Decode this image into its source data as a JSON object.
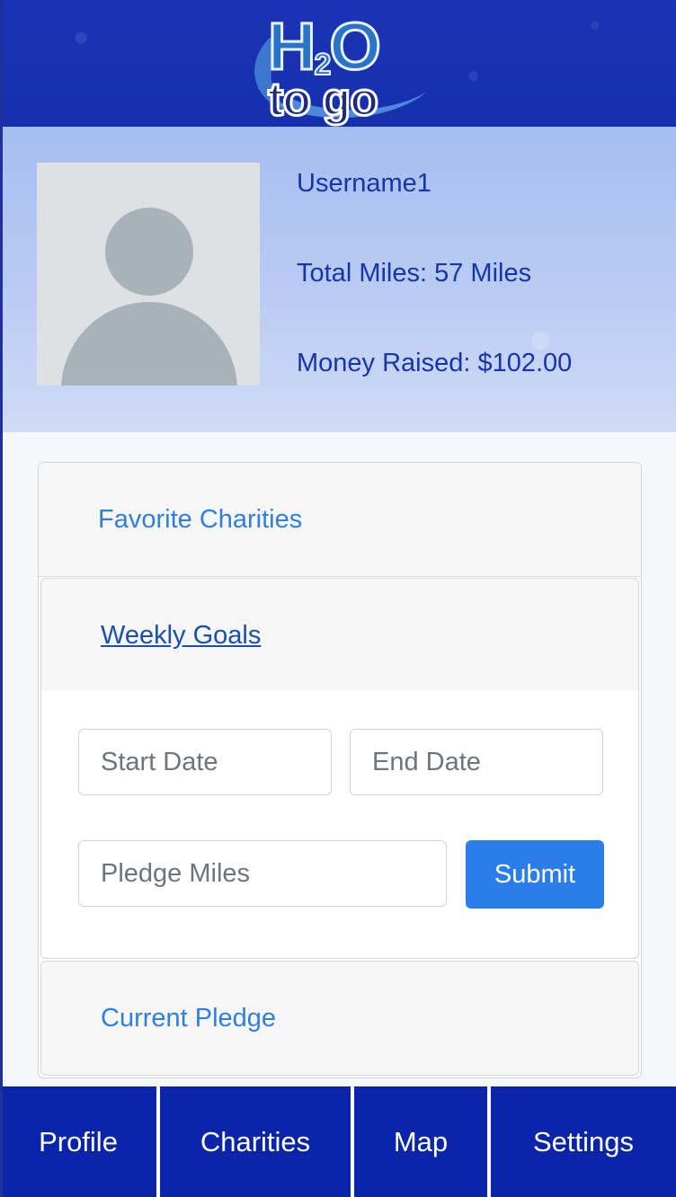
{
  "app": {
    "logo_line1": "H",
    "logo_sub": "2",
    "logo_line1b": "O",
    "logo_line2": "to go"
  },
  "profile": {
    "username": "Username1",
    "total_miles": "Total Miles: 57 Miles",
    "money_raised": "Money Raised: $102.00"
  },
  "accordion": {
    "favorite_charities": "Favorite Charities",
    "weekly_goals": "Weekly Goals",
    "current_pledge": "Current Pledge"
  },
  "form": {
    "start_date_placeholder": "Start Date",
    "end_date_placeholder": "End Date",
    "pledge_miles_placeholder": "Pledge Miles",
    "submit_label": "Submit"
  },
  "nav": {
    "items": [
      {
        "label": "Profile"
      },
      {
        "label": "Charities"
      },
      {
        "label": "Map"
      },
      {
        "label": "Settings"
      }
    ]
  },
  "colors": {
    "header_bg": "#1530ae",
    "nav_bg": "#0a24aa",
    "accent": "#2b7de9",
    "profile_text": "#1636a8"
  }
}
